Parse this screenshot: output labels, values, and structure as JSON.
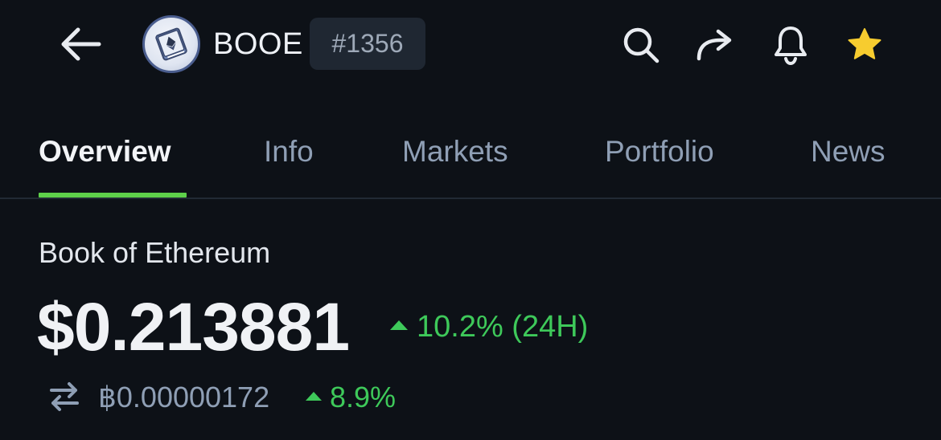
{
  "header": {
    "back_icon": "arrow-left-icon",
    "coin_logo": "book-of-ethereum-logo",
    "symbol": "BOOE",
    "rank": "#1356",
    "icons": [
      "search-icon",
      "share-icon",
      "bell-icon",
      "star-icon"
    ],
    "star_color": "#f7cc2f"
  },
  "tabs": [
    {
      "label": "Overview",
      "active": true
    },
    {
      "label": "Info",
      "active": false
    },
    {
      "label": "Markets",
      "active": false
    },
    {
      "label": "Portfolio",
      "active": false
    },
    {
      "label": "News",
      "active": false
    }
  ],
  "coin": {
    "name": "Book of Ethereum",
    "price": "$0.213881",
    "change_24h": "10.2% (24H)",
    "btc_price": "฿0.00000172",
    "btc_change": "8.9%"
  },
  "colors": {
    "background": "#0d1117",
    "positive": "#3ec95a",
    "tab_indicator": "#5ed04a",
    "muted_text": "#8f9fb5"
  }
}
